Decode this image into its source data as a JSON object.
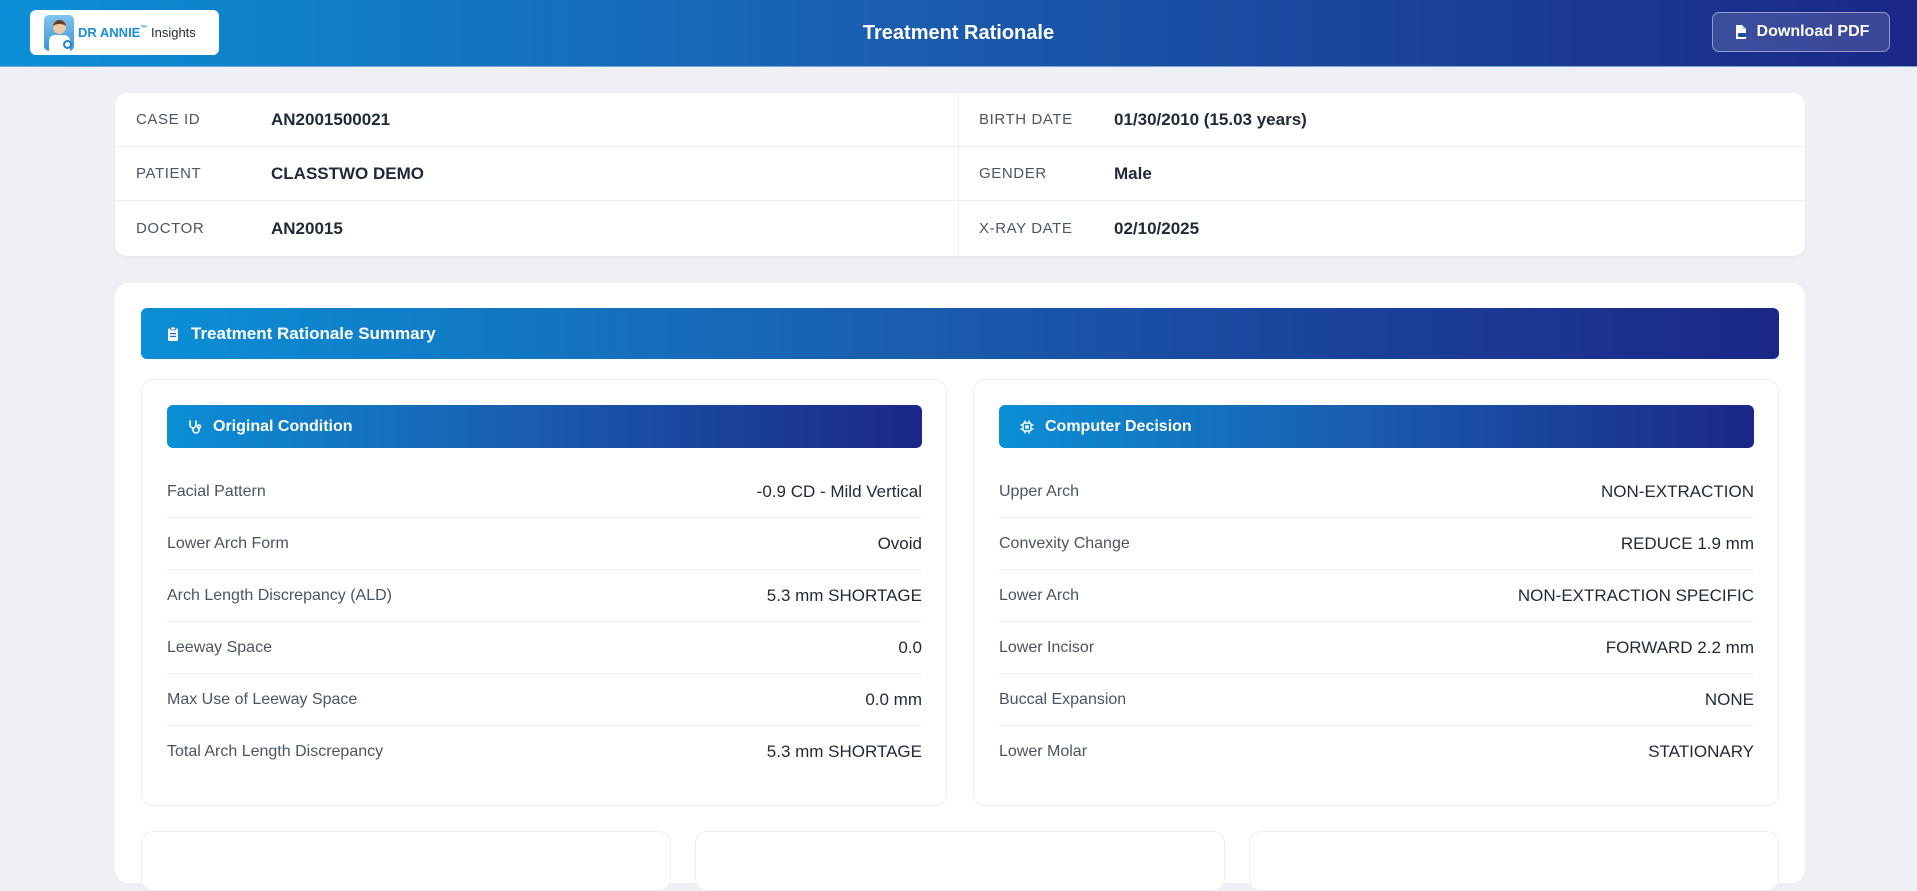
{
  "header": {
    "logo_brand": "DR ANNIE",
    "logo_tm": "™",
    "logo_suffix": "Insights",
    "title": "Treatment Rationale",
    "download_label": "Download PDF"
  },
  "case_info": {
    "left": [
      {
        "label": "CASE ID",
        "value": "AN2001500021"
      },
      {
        "label": "PATIENT",
        "value": "CLASSTWO DEMO"
      },
      {
        "label": "DOCTOR",
        "value": "AN20015"
      }
    ],
    "right": [
      {
        "label": "BIRTH DATE",
        "value": "01/30/2010 (15.03 years)"
      },
      {
        "label": "GENDER",
        "value": "Male"
      },
      {
        "label": "X-RAY DATE",
        "value": "02/10/2025"
      }
    ]
  },
  "summary": {
    "title": "Treatment Rationale Summary",
    "original_condition": {
      "title": "Original Condition",
      "rows": [
        {
          "label": "Facial Pattern",
          "value": "-0.9 CD - Mild Vertical"
        },
        {
          "label": "Lower Arch Form",
          "value": "Ovoid"
        },
        {
          "label": "Arch Length Discrepancy (ALD)",
          "value": "5.3 mm SHORTAGE"
        },
        {
          "label": "Leeway Space",
          "value": "0.0"
        },
        {
          "label": "Max Use of Leeway Space",
          "value": "0.0 mm"
        },
        {
          "label": "Total Arch Length Discrepancy",
          "value": "5.3 mm SHORTAGE"
        }
      ]
    },
    "computer_decision": {
      "title": "Computer Decision",
      "rows": [
        {
          "label": "Upper Arch",
          "value": "NON-EXTRACTION"
        },
        {
          "label": "Convexity Change",
          "value": "REDUCE 1.9 mm"
        },
        {
          "label": "Lower Arch",
          "value": "NON-EXTRACTION SPECIFIC"
        },
        {
          "label": "Lower Incisor",
          "value": "FORWARD 2.2 mm"
        },
        {
          "label": "Buccal Expansion",
          "value": "NONE"
        },
        {
          "label": "Lower Molar",
          "value": "STATIONARY"
        }
      ]
    }
  },
  "icons": {
    "download": "file-pdf-icon",
    "summary": "clipboard-icon",
    "original_condition": "stethoscope-icon",
    "computer_decision": "cpu-chip-icon"
  },
  "colors": {
    "gradient_start": "#0b8fd6",
    "gradient_end": "#1b2787",
    "background": "#eef0f6"
  }
}
